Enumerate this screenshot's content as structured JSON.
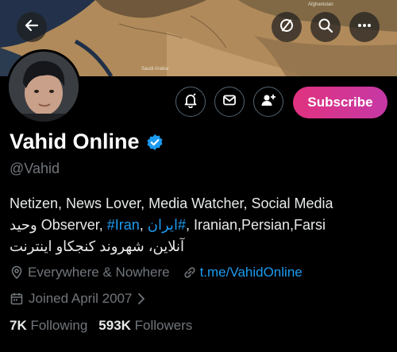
{
  "banner": {
    "map_labels": [
      "Afghanistan",
      "Saudi Arabia"
    ]
  },
  "profile": {
    "name": "Vahid Online",
    "handle": "@Vahid",
    "verified": true
  },
  "bio": {
    "line1": "Netizen, News Lover, Media Watcher, Social Media",
    "line2_fa_name": "وحید",
    "line2_observer": " Observer, ",
    "tag_iran": "#Iran",
    "comma1": ", ",
    "tag_iran_fa": "#ایران",
    "line2_rest": ", Iranian,Persian,Farsi",
    "line3": "آنلاین، شهروند کنجکاو اینترنت"
  },
  "meta": {
    "location": "Everywhere & Nowhere",
    "link": "t.me/VahidOnline",
    "joined": "Joined April 2007"
  },
  "stats": {
    "following_count": "7K",
    "following_label": "Following",
    "followers_count": "593K",
    "followers_label": "Followers"
  },
  "actions": {
    "subscribe_label": "Subscribe"
  },
  "colors": {
    "accent": "#1d9bf0",
    "subscribe_start": "#e0327f",
    "subscribe_end": "#c638a5",
    "muted": "#71767b"
  },
  "icons": [
    "back-arrow-icon",
    "slashed-circle-icon",
    "search-icon",
    "more-icon",
    "notification-bell-icon",
    "mail-icon",
    "add-person-icon",
    "verified-badge-icon",
    "location-pin-icon",
    "link-icon",
    "calendar-icon",
    "chevron-right-icon"
  ]
}
